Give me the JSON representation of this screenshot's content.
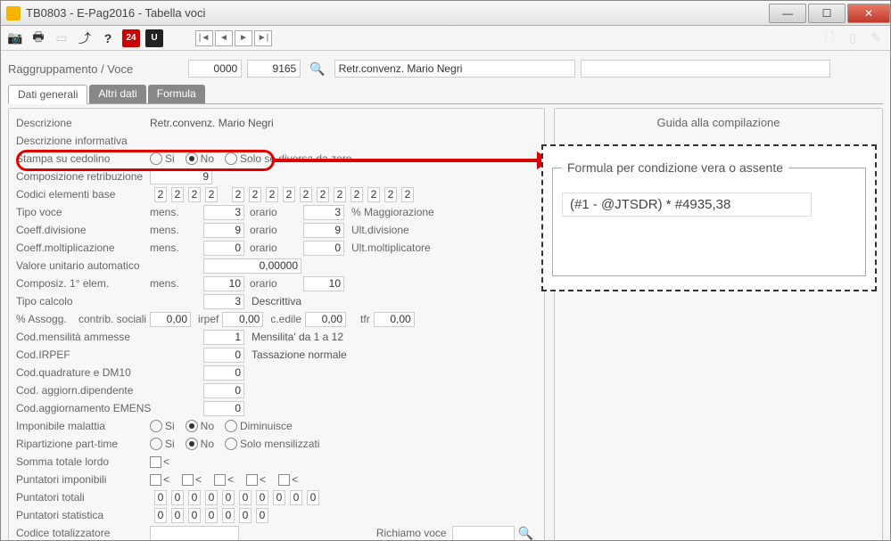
{
  "window": {
    "title": "TB0803  -  E-Pag2016  -  Tabella voci"
  },
  "toolbar": {
    "badge24": "24",
    "badgeU": "U"
  },
  "header": {
    "label": "Raggruppamento / Voce",
    "code1": "0000",
    "code2": "9165",
    "desc": "Retr.convenz. Mario Negri"
  },
  "tabs": {
    "t1": "Dati generali",
    "t2": "Altri dati",
    "t3": "Formula"
  },
  "labels": {
    "descrizione": "Descrizione",
    "desc_info": "Descrizione informativa",
    "stampa": "Stampa su cedolino",
    "composizione": "Composizione retribuzione",
    "codici_elem": "Codici elementi base",
    "tipo_voce": "Tipo voce",
    "coeff_div": "Coeff.divisione",
    "coeff_mol": "Coeff.moltiplicazione",
    "valore_unit": "Valore unitario automatico",
    "composiz1": "Composiz. 1° elem.",
    "tipo_calcolo": "Tipo calcolo",
    "assogg": "% Assogg.",
    "cod_mens": "Cod.mensilità ammesse",
    "cod_irpef": "Cod.IRPEF",
    "cod_quad": "Cod.quadrature e DM10",
    "cod_agg_dip": "Cod. aggiorn.dipendente",
    "cod_agg_emens": "Cod.aggiornamento EMENS",
    "imponibile": "Imponibile malattia",
    "ripartizione": "Ripartizione part-time",
    "somma": "Somma totale lordo",
    "punt_imp": "Puntatori imponibili",
    "punt_tot": "Puntatori totali",
    "punt_stat": "Puntatori statistica",
    "cod_total": "Codice totalizzatore",
    "richiamo": "Richiamo voce",
    "mens": "mens.",
    "orario": "orario",
    "pct_magg": "% Maggiorazione",
    "ult_div": "Ult.divisione",
    "ult_mol": "Ult.moltiplicatore",
    "contrib": "contrib. sociali",
    "irpef": "irpef",
    "cedile": "c.edile",
    "tfr": "tfr",
    "si": "Si",
    "no": "No",
    "solo_diversa": "Solo se diversa da zero",
    "diminuisce": "Diminuisce",
    "solo_mens": "Solo mensilizzati",
    "lt": "<"
  },
  "values": {
    "descrizione": "Retr.convenz. Mario Negri",
    "composizione": "9",
    "codici": [
      "2",
      "2",
      "2",
      "2",
      "2",
      "2",
      "2",
      "2",
      "2",
      "2",
      "2",
      "2",
      "2",
      "2",
      "2"
    ],
    "tipo_voce_m": "3",
    "tipo_voce_o": "3",
    "coeff_div_m": "9",
    "coeff_div_o": "9",
    "coeff_mol_m": "0",
    "coeff_mol_o": "0",
    "valore_unit": "0,00000",
    "composiz1_m": "10",
    "composiz1_o": "10",
    "tipo_calcolo": "3",
    "tipo_calcolo_desc": "Descrittiva",
    "assogg_cs": "0,00",
    "assogg_irpef": "0,00",
    "assogg_cedile": "0,00",
    "assogg_tfr": "0,00",
    "cod_mens": "1",
    "cod_mens_desc": "Mensilita' da 1 a 12",
    "cod_irpef": "0",
    "cod_irpef_desc": "Tassazione normale",
    "cod_quad": "0",
    "cod_agg_dip": "0",
    "cod_agg_emens": "0",
    "punt_tot": [
      "0",
      "0",
      "0",
      "0",
      "0",
      "0",
      "0",
      "0",
      "0",
      "0"
    ],
    "punt_stat": [
      "0",
      "0",
      "0",
      "0",
      "0",
      "0",
      "0"
    ]
  },
  "rightpanel": {
    "title": "Guida alla compilazione"
  },
  "popup": {
    "legend": "Formula per condizione vera o assente",
    "formula": "(#1 - @JTSDR) * #4935,38"
  }
}
